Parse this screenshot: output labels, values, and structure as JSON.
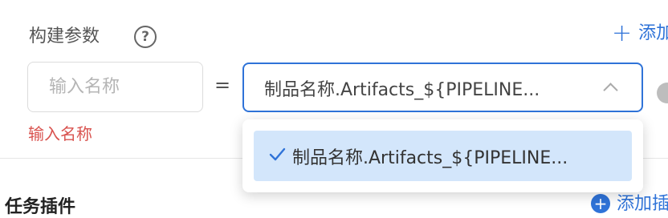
{
  "build_params": {
    "label": "构建参数",
    "help_glyph": "?",
    "add_label": "添加",
    "add_glyph": "+"
  },
  "param_row": {
    "name_placeholder": "输入名称",
    "equals": "=",
    "selected_value": "制品名称.Artifacts_${PIPELINE...",
    "error": "输入名称"
  },
  "dropdown": {
    "options": [
      {
        "label": "制品名称.Artifacts_${PIPELINE...",
        "selected": true
      }
    ]
  },
  "task_plugins": {
    "label": "任务插件",
    "add_label": "添加插件"
  },
  "colors": {
    "accent": "#2f73d8",
    "error": "#d9534f",
    "option_highlight": "#d3e6fb"
  }
}
